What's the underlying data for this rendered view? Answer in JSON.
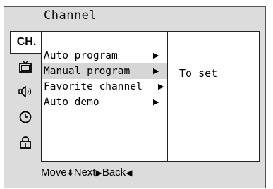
{
  "header": {
    "title": "Channel"
  },
  "sidebar": {
    "items": [
      {
        "label": "CH.",
        "icon": "channel-icon"
      },
      {
        "label": "",
        "icon": "tv-icon"
      },
      {
        "label": "",
        "icon": "speaker-icon"
      },
      {
        "label": "",
        "icon": "clock-icon"
      },
      {
        "label": "",
        "icon": "lock-icon"
      }
    ]
  },
  "menu": {
    "items": [
      {
        "label": "Auto program",
        "arrow": "▶"
      },
      {
        "label": "Manual program",
        "arrow": "▶"
      },
      {
        "label": "Favorite channel",
        "arrow": "▶"
      },
      {
        "label": "Auto demo",
        "arrow": "▶"
      }
    ]
  },
  "submenu": {
    "value": "To set"
  },
  "footer": {
    "move_label": "Move",
    "move_glyph": "⬍",
    "next_label": "Next",
    "next_glyph": "▶",
    "back_label": "Back",
    "back_glyph": "◀"
  },
  "colors": {
    "frame_bg": "#dcdcdc",
    "panel_bg": "#ffffff",
    "highlight_bg": "#d6d6d6",
    "text": "#000000"
  }
}
